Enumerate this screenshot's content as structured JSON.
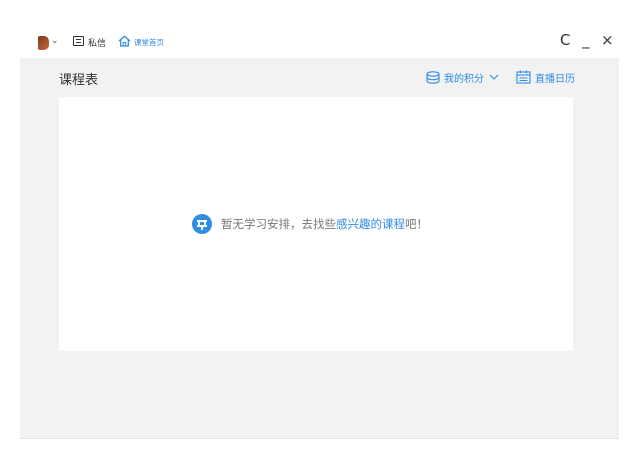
{
  "topbar": {
    "private_message_label": "私信",
    "home_label": "课堂首页",
    "window_controls": {
      "refresh": "C",
      "minimize": "_",
      "close": "×"
    }
  },
  "page": {
    "title": "课程表",
    "points_label": "我的积分",
    "live_calendar_label": "直播日历"
  },
  "empty_state": {
    "text_before": "暂无学习安排，去找些",
    "link_text": "感兴趣的课程",
    "text_after": "吧！"
  },
  "colors": {
    "accent": "#2f8de4",
    "panel_bg": "#f2f2f2"
  },
  "icons": [
    "avatar",
    "chevron-down-icon",
    "message-icon",
    "home-icon",
    "database-icon",
    "calendar-icon",
    "empty-state-icon"
  ]
}
